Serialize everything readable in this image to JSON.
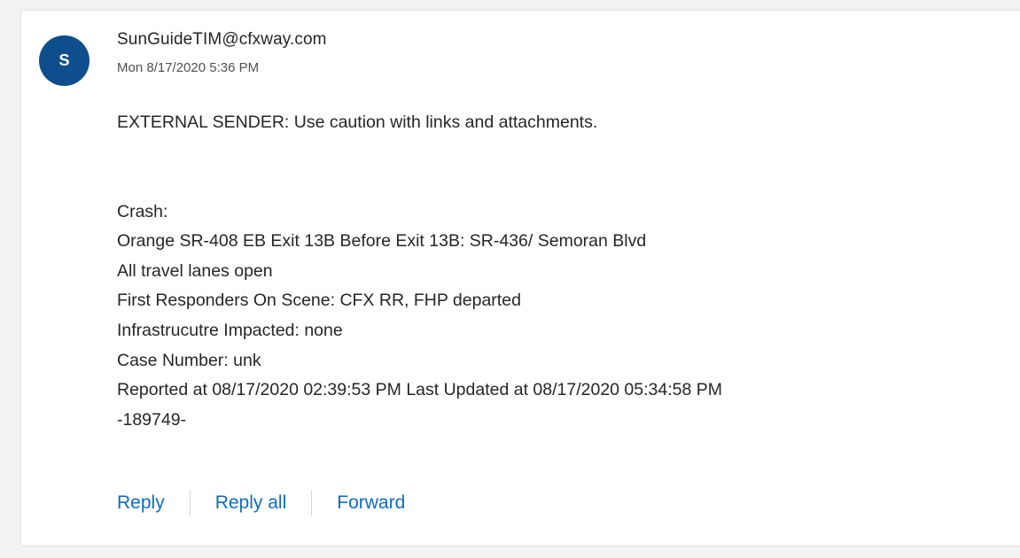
{
  "message": {
    "avatar_initial": "S",
    "sender": "SunGuideTIM@cfxway.com",
    "timestamp": "Mon 8/17/2020 5:36 PM",
    "warning": "EXTERNAL SENDER: Use caution with links and attachments.",
    "body_lines": [
      "Crash:",
      "Orange SR-408 EB Exit 13B Before Exit 13B: SR-436/ Semoran Blvd",
      "All travel lanes open",
      "First Responders On Scene: CFX RR, FHP departed",
      "Infrastrucutre Impacted: none",
      "Case Number: unk",
      "Reported at 08/17/2020 02:39:53 PM Last Updated at 08/17/2020 05:34:58 PM",
      "-189749-"
    ]
  },
  "actions": {
    "reply": "Reply",
    "reply_all": "Reply all",
    "forward": "Forward"
  },
  "colors": {
    "avatar_bg": "#0f4e8c",
    "link": "#0f6cbd"
  }
}
